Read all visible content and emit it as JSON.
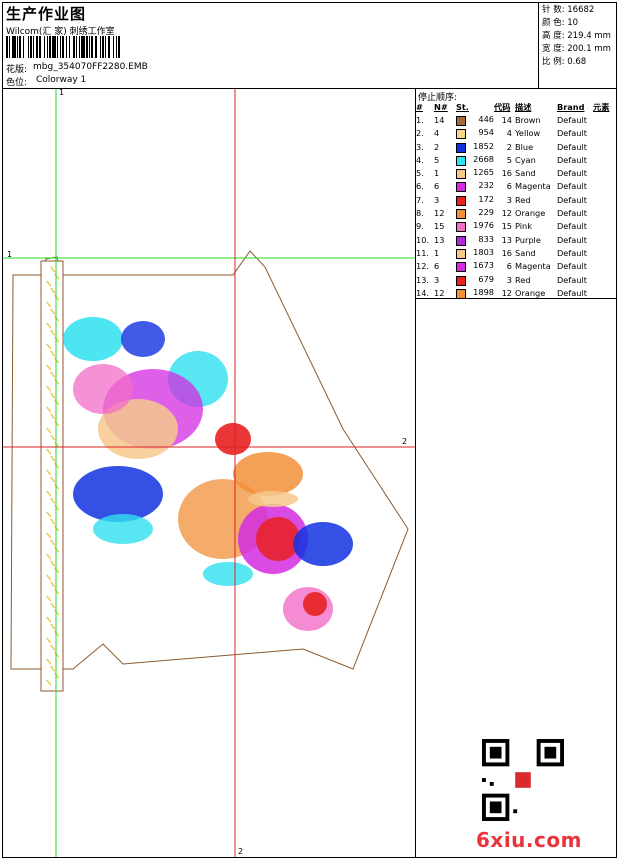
{
  "header": {
    "title": "生产作业图",
    "company": "Wilcom(汇 家) 刺绣工作室",
    "design_label": "花版:",
    "design_name": "mbg_354070FF2280.EMB",
    "colorway_label": "色位:",
    "colorway": "Colorway 1"
  },
  "stats": {
    "stitches": "针 数:  16682",
    "colors": "颜 色:  10",
    "height": "高 度:  219.4 mm",
    "width": "宽 度:  200.1 mm",
    "scale": "比 例:  0.68"
  },
  "stop_sequence": {
    "title": "停止顺序:",
    "headers": [
      "#",
      "N#",
      "St.",
      "代码",
      "描述",
      "Brand",
      "元素"
    ],
    "rows": [
      {
        "idx": "1.",
        "n": "14",
        "color": "#9b6a40",
        "st": "446",
        "code": "14",
        "desc": "Brown",
        "brand": "Default"
      },
      {
        "idx": "2.",
        "n": "4",
        "color": "#f7d486",
        "st": "954",
        "code": "4",
        "desc": "Yellow",
        "brand": "Default"
      },
      {
        "idx": "3.",
        "n": "2",
        "color": "#1232e0",
        "st": "1852",
        "code": "2",
        "desc": "Blue",
        "brand": "Default"
      },
      {
        "idx": "4.",
        "n": "5",
        "color": "#2fe0f0",
        "st": "2668",
        "code": "5",
        "desc": "Cyan",
        "brand": "Default"
      },
      {
        "idx": "5.",
        "n": "1",
        "color": "#f6c88c",
        "st": "1265",
        "code": "16",
        "desc": "Sand",
        "brand": "Default"
      },
      {
        "idx": "6.",
        "n": "6",
        "color": "#d42be0",
        "st": "232",
        "code": "6",
        "desc": "Magenta",
        "brand": "Default"
      },
      {
        "idx": "7.",
        "n": "3",
        "color": "#e82020",
        "st": "172",
        "code": "3",
        "desc": "Red",
        "brand": "Default"
      },
      {
        "idx": "8.",
        "n": "12",
        "color": "#f2903a",
        "st": "229",
        "code": "12",
        "desc": "Orange",
        "brand": "Default"
      },
      {
        "idx": "9.",
        "n": "15",
        "color": "#f26ec8",
        "st": "1976",
        "code": "15",
        "desc": "Pink",
        "brand": "Default"
      },
      {
        "idx": "10.",
        "n": "13",
        "color": "#b02ad8",
        "st": "833",
        "code": "13",
        "desc": "Purple",
        "brand": "Default"
      },
      {
        "idx": "11.",
        "n": "1",
        "color": "#f6c88c",
        "st": "1803",
        "code": "16",
        "desc": "Sand",
        "brand": "Default"
      },
      {
        "idx": "12.",
        "n": "6",
        "color": "#d42be0",
        "st": "1673",
        "code": "6",
        "desc": "Magenta",
        "brand": "Default"
      },
      {
        "idx": "13.",
        "n": "3",
        "color": "#e82020",
        "st": "679",
        "code": "3",
        "desc": "Red",
        "brand": "Default"
      },
      {
        "idx": "14.",
        "n": "12",
        "color": "#f2903a",
        "st": "1898",
        "code": "12",
        "desc": "Orange",
        "brand": "Default"
      }
    ]
  },
  "guides": {
    "v_green": "1",
    "h_green": "1",
    "v_red": "2",
    "h_red": "2"
  },
  "watermark": "6xiu.com"
}
